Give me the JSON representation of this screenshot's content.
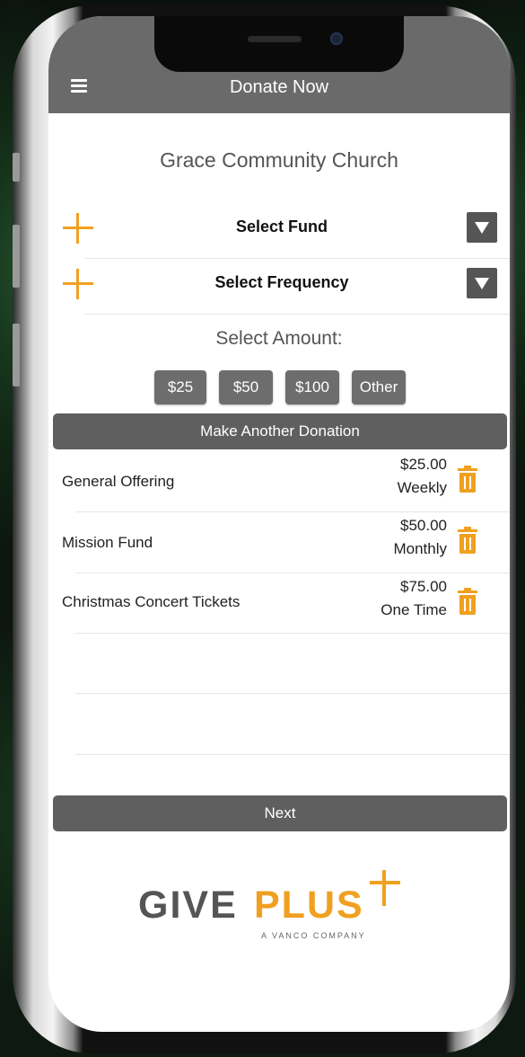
{
  "header": {
    "title": "Donate Now"
  },
  "organization": "Grace Community Church",
  "fund_select": {
    "label": "Select Fund"
  },
  "frequency_select": {
    "label": "Select Frequency"
  },
  "amount": {
    "title": "Select Amount:",
    "options": [
      "$25",
      "$50",
      "$100",
      "Other"
    ]
  },
  "make_another_label": "Make Another Donation",
  "donations": [
    {
      "name": "General Offering",
      "amount": "$25.00",
      "frequency": "Weekly"
    },
    {
      "name": "Mission Fund",
      "amount": "$50.00",
      "frequency": "Monthly"
    },
    {
      "name": "Christmas Concert Tickets",
      "amount": "$75.00",
      "frequency": "One Time"
    }
  ],
  "next_label": "Next",
  "logo": {
    "give": "GIVE",
    "plus": "PLUS",
    "tagline": "A VANCO COMPANY"
  },
  "colors": {
    "accent": "#f0a020",
    "header": "#6a6a6a",
    "button": "#6d6d6d"
  }
}
